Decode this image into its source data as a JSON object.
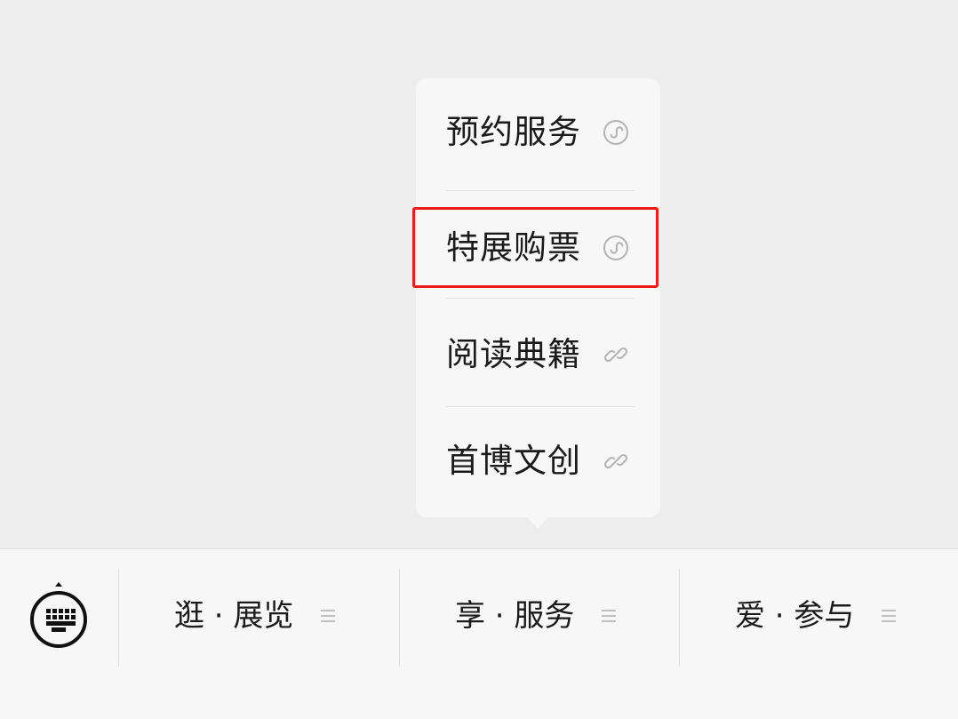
{
  "popup_menu": {
    "items": [
      {
        "label": "预约服务",
        "icon": "mini-program-icon"
      },
      {
        "label": "特展购票",
        "icon": "mini-program-icon"
      },
      {
        "label": "阅读典籍",
        "icon": "link-icon"
      },
      {
        "label": "首博文创",
        "icon": "link-icon"
      }
    ],
    "highlighted_item": "特展购票",
    "highlight_color": "#ef1c1c"
  },
  "tab_bar": {
    "keyboard_icon": "keyboard-icon",
    "tabs": [
      {
        "label": "逛 · 展览",
        "icon": "menu-lines-icon"
      },
      {
        "label": "享 · 服务",
        "icon": "menu-lines-icon"
      },
      {
        "label": "爱 · 参与",
        "icon": "menu-lines-icon"
      }
    ]
  },
  "colors": {
    "background": "#ededed",
    "popup_background": "#f7f7f7",
    "text": "#1b1b1b",
    "icon_gray": "#b3b3b3"
  }
}
